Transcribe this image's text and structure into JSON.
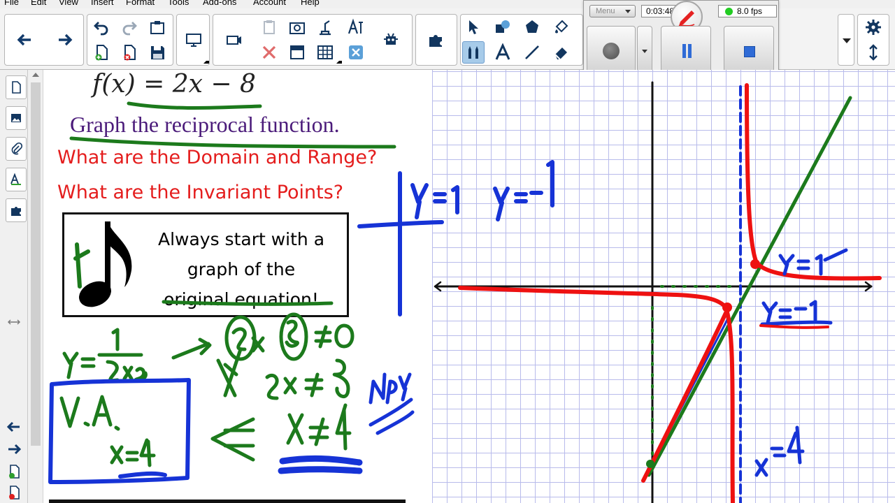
{
  "menu": {
    "items": [
      "File",
      "Edit",
      "View",
      "Insert",
      "Format",
      "Tools",
      "Add-ons",
      "Account",
      "Help"
    ]
  },
  "icons": {
    "toolbar": [
      "back-arrow",
      "forward-arrow",
      "undo",
      "redo",
      "screen-capture",
      "new-page",
      "delete-page",
      "save",
      "display-screen",
      "camera",
      "paste",
      "clear",
      "capture",
      "document-camera",
      "screen-shade",
      "table",
      "fullscreen",
      "add-ons",
      "puzzle",
      "select-arrow",
      "shapes",
      "polygon",
      "fill",
      "pens",
      "text",
      "line",
      "eraser",
      "gear",
      "resize-arrows"
    ],
    "side": [
      "page-sorter",
      "gallery",
      "attachments",
      "properties",
      "add-ons",
      "resize",
      "back",
      "forward",
      "add-page",
      "delete-page"
    ]
  },
  "recorder": {
    "menu_label": "Menu",
    "time": "0:03:48",
    "fps": "8.0 fps",
    "status_color": "#22cc22"
  },
  "slide": {
    "function": "f(x) = 2x − 8",
    "title": "Graph the reciprocal function.",
    "question1": "What are the Domain and Range?",
    "question2": "What are the Invariant Points?",
    "note_line1": "Always start with a",
    "note_line2": "graph of the",
    "note_line3": "original equation!"
  },
  "colors": {
    "title": "#4b1b7a",
    "questions": "#e41d1d",
    "ink_blue": "#1633d6",
    "ink_green": "#1c7a1c",
    "ink_red": "#ee1111",
    "grid": "#b8bbeb"
  }
}
